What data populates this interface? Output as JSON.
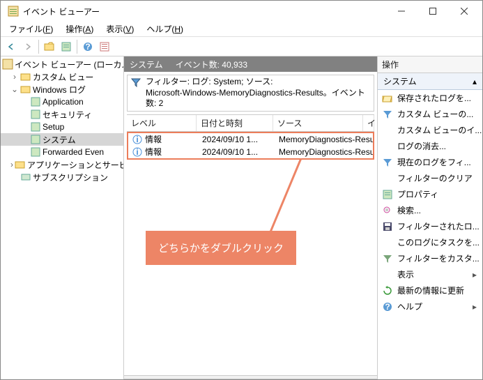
{
  "window": {
    "title": "イベント ビューアー"
  },
  "menus": {
    "file": "ファイル(",
    "file_u": "F",
    "action": "操作(",
    "action_u": "A",
    "view": "表示(",
    "view_u": "V",
    "help": "ヘルプ(",
    "help_u": "H",
    "close_paren": ")"
  },
  "tree": {
    "root": "イベント ビューアー (ローカル",
    "custom": "カスタム ビュー",
    "winlog": "Windows ログ",
    "items": {
      "app": "Application",
      "sec": "セキュリティ",
      "setup": "Setup",
      "sys": "システム",
      "fwd": "Forwarded Even"
    },
    "appsvc": "アプリケーションとサービ",
    "sub": "サブスクリプション"
  },
  "center": {
    "title": "システム",
    "count_label": "イベント数: 40,933",
    "filter_line1": "フィルター: ログ: System; ソース:",
    "filter_line2": "Microsoft-Windows-MemoryDiagnostics-Results。イベント数: 2",
    "headers": {
      "level": "レベル",
      "date": "日付と時刻",
      "source": "ソース",
      "ev": "イ"
    },
    "rows": [
      {
        "level": "情報",
        "date": "2024/09/10 1...",
        "source": "MemoryDiagnostics-Results"
      },
      {
        "level": "情報",
        "date": "2024/09/10 1...",
        "source": "MemoryDiagnostics-Results"
      }
    ]
  },
  "annotation": {
    "text": "どちらかをダブルクリック"
  },
  "actions": {
    "title": "操作",
    "section": "システム",
    "items": {
      "open_saved": "保存されたログを...",
      "custom_view": "カスタム ビューの...",
      "custom_view_i": "カスタム ビューのイ...",
      "clear_log": "ログの消去...",
      "filter_current": "現在のログをフィ...",
      "clear_filter": "フィルターのクリア",
      "properties": "プロパティ",
      "search": "検索...",
      "save_filtered": "フィルターされたロ...",
      "attach_task": "このログにタスクを...",
      "custom_filter": "フィルターをカスタ...",
      "view": "表示",
      "refresh": "最新の情報に更新",
      "help": "ヘルプ"
    }
  }
}
